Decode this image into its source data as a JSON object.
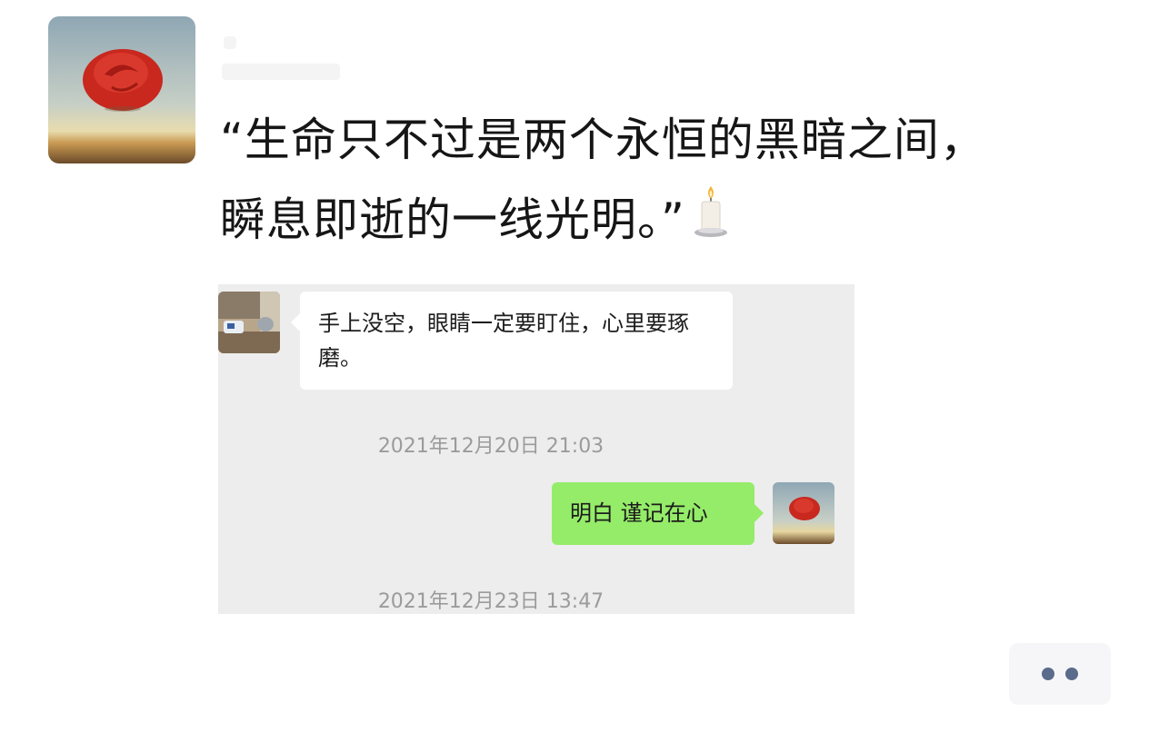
{
  "post": {
    "text_line1": "“生命只不过是两个永恒的黑暗之间，",
    "text_line2": "瞬息即逝的一线光明。”",
    "emoji_icon": "candle-icon",
    "author_avatar": "rose-painting-avatar"
  },
  "chat_screenshot": {
    "incoming_message": "手上没空，眼睛一定要盯住，心里要琢磨。",
    "timestamp_1": "2021年12月20日 21:03",
    "outgoing_message": "明白 谨记在心",
    "timestamp_2": "2021年12月23日 13:47",
    "colors": {
      "background": "#ededed",
      "incoming_bubble": "#ffffff",
      "outgoing_bubble": "#95ec69"
    }
  },
  "actions": {
    "more_icon": "more-dots-icon"
  }
}
